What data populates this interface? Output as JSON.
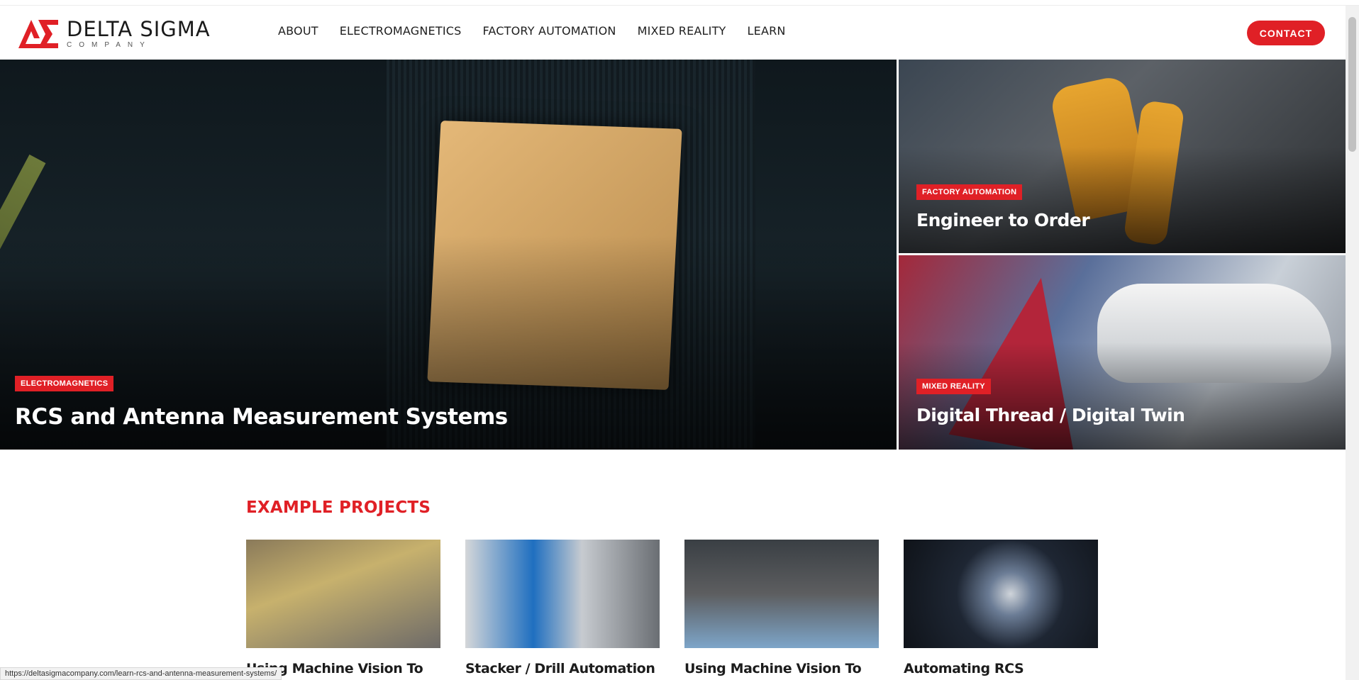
{
  "header": {
    "logo": {
      "name": "DELTA SIGMA",
      "sub": "COMPANY"
    },
    "nav": [
      {
        "label": "ABOUT"
      },
      {
        "label": "ELECTROMAGNETICS"
      },
      {
        "label": "FACTORY AUTOMATION"
      },
      {
        "label": "MIXED REALITY"
      },
      {
        "label": "LEARN"
      }
    ],
    "contact_label": "CONTACT"
  },
  "hero": {
    "main": {
      "tag": "ELECTROMAGNETICS",
      "title": "RCS and Antenna Measurement Systems"
    },
    "top_right": {
      "tag": "FACTORY AUTOMATION",
      "title": "Engineer to Order"
    },
    "bottom_right": {
      "tag": "MIXED REALITY",
      "title": "Digital Thread / Digital Twin"
    }
  },
  "projects": {
    "heading": "EXAMPLE PROJECTS",
    "items": [
      {
        "title": "Using Machine Vision To"
      },
      {
        "title": "Stacker / Drill Automation"
      },
      {
        "title": "Using Machine Vision To"
      },
      {
        "title": "Automating RCS"
      }
    ]
  },
  "status_bar": {
    "url": "https://deltasigmacompany.com/learn-rcs-and-antenna-measurement-systems/"
  },
  "colors": {
    "accent": "#e02026",
    "text": "#1e1e1e"
  }
}
